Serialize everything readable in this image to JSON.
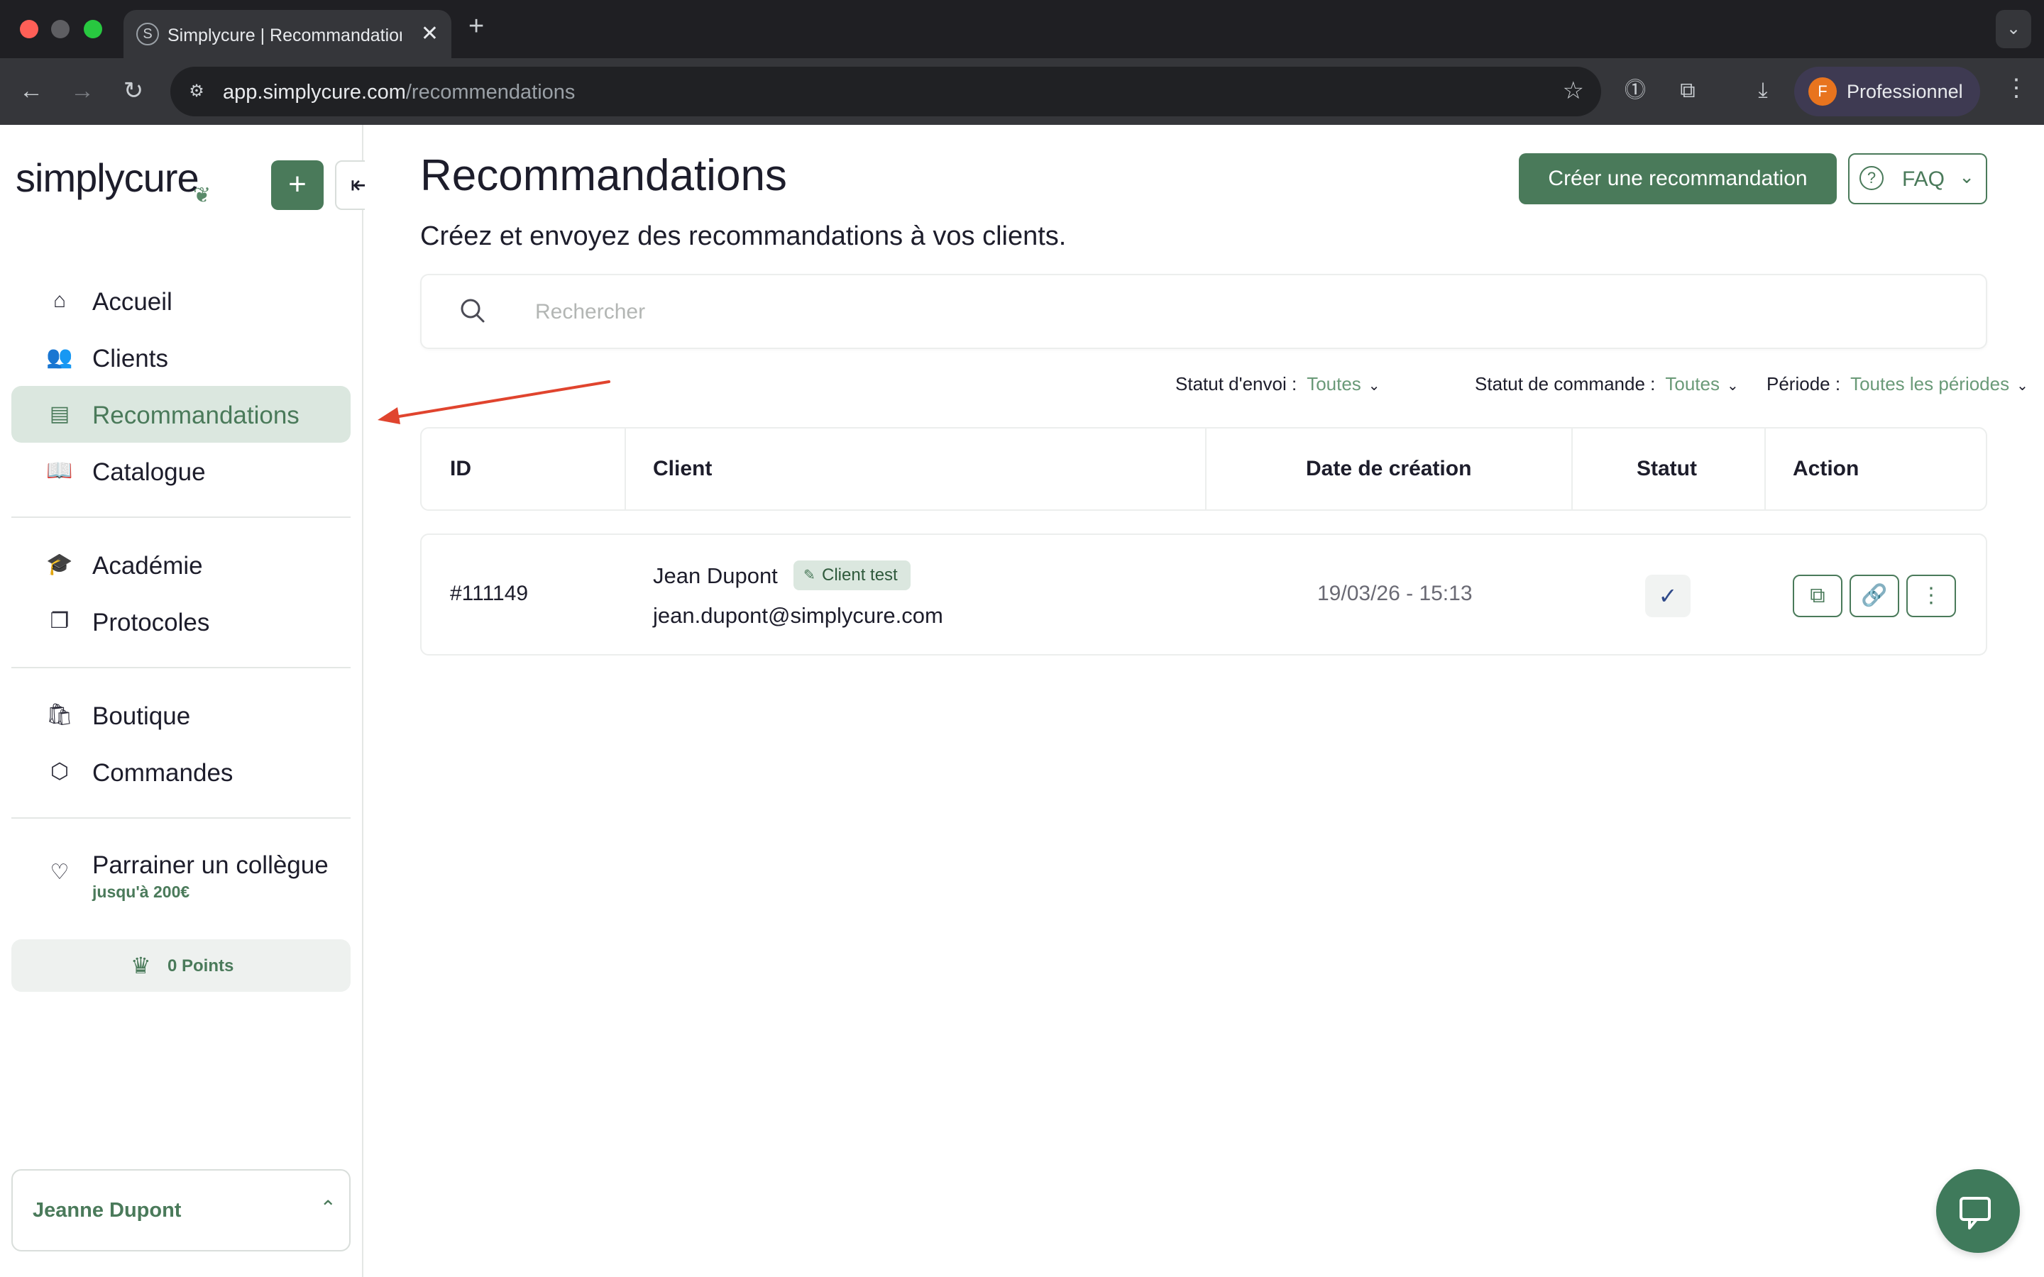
{
  "browser": {
    "tab_title": "Simplycure | Recommandations",
    "tab_favicon": "S",
    "url_host": "app.simplycure.com",
    "url_path": "/recommendations",
    "profile_initial": "F",
    "profile_name": "Professionnel"
  },
  "sidebar": {
    "logo": "simplycure",
    "items": [
      {
        "label": "Accueil",
        "icon": "home-icon"
      },
      {
        "label": "Clients",
        "icon": "users-icon"
      },
      {
        "label": "Recommandations",
        "icon": "document-icon",
        "active": true
      },
      {
        "label": "Catalogue",
        "icon": "book-icon"
      },
      {
        "label": "Académie",
        "icon": "graduation-cap-icon"
      },
      {
        "label": "Protocoles",
        "icon": "copy-icon"
      },
      {
        "label": "Boutique",
        "icon": "shopping-bag-icon"
      },
      {
        "label": "Commandes",
        "icon": "package-icon"
      }
    ],
    "sponsor": {
      "label": "Parrainer un collègue",
      "sub": "jusqu'à 200€",
      "icon": "heart-handshake-icon"
    },
    "points": "0 Points",
    "user_name": "Jeanne Dupont"
  },
  "main": {
    "title": "Recommandations",
    "subtitle": "Créez et envoyez des recommandations à vos clients.",
    "create_button": "Créer une recommandation",
    "faq_button": "FAQ",
    "search_placeholder": "Rechercher",
    "filters": {
      "send_status_label": "Statut d'envoi :",
      "send_status_value": "Toutes",
      "order_status_label": "Statut de commande :",
      "order_status_value": "Toutes",
      "period_label": "Période :",
      "period_value": "Toutes les périodes"
    },
    "table": {
      "headers": [
        "ID",
        "Client",
        "Date de création",
        "Statut",
        "Action"
      ],
      "rows": [
        {
          "id": "#111149",
          "client_name": "Jean Dupont",
          "client_badge": "Client test",
          "client_email": "jean.dupont@simplycure.com",
          "date": "19/03/26 - 15:13",
          "status": "sent"
        }
      ]
    }
  },
  "colors": {
    "brand_green": "#4a7a5a",
    "active_bg": "#dbe7df",
    "annotation_arrow": "#e0442e"
  }
}
